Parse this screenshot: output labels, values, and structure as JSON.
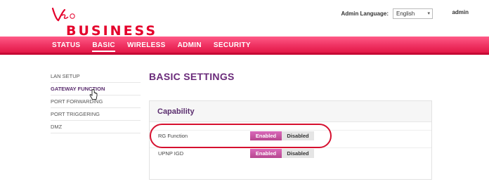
{
  "brand": {
    "logo_script": "Virgin media",
    "product": "BUSINESS",
    "color": "#e4002b"
  },
  "header": {
    "language_label": "Admin Language:",
    "language_value": "English",
    "user": "admin"
  },
  "nav": {
    "items": [
      "STATUS",
      "BASIC",
      "WIRELESS",
      "ADMIN",
      "SECURITY"
    ],
    "active": "BASIC"
  },
  "sidebar": {
    "items": [
      "LAN SETUP",
      "GATEWAY FUNCTION",
      "PORT FORWARDING",
      "PORT TRIGGERING",
      "DMZ"
    ],
    "active": "GATEWAY FUNCTION"
  },
  "main": {
    "title": "BASIC SETTINGS",
    "panel_title": "Capability",
    "rows": [
      {
        "label": "RG Function",
        "enabled": "Enabled",
        "disabled": "Disabled",
        "state": "Enabled"
      },
      {
        "label": "UPNP IGD",
        "enabled": "Enabled",
        "disabled": "Disabled",
        "state": "Enabled"
      }
    ]
  },
  "colors": {
    "nav_gradient_top": "#ff5b87",
    "nav_gradient_bottom": "#e0103f",
    "accent_purple": "#6a2a7a",
    "enabled_pink": "#c456a4",
    "highlight_red": "#d6102f"
  }
}
